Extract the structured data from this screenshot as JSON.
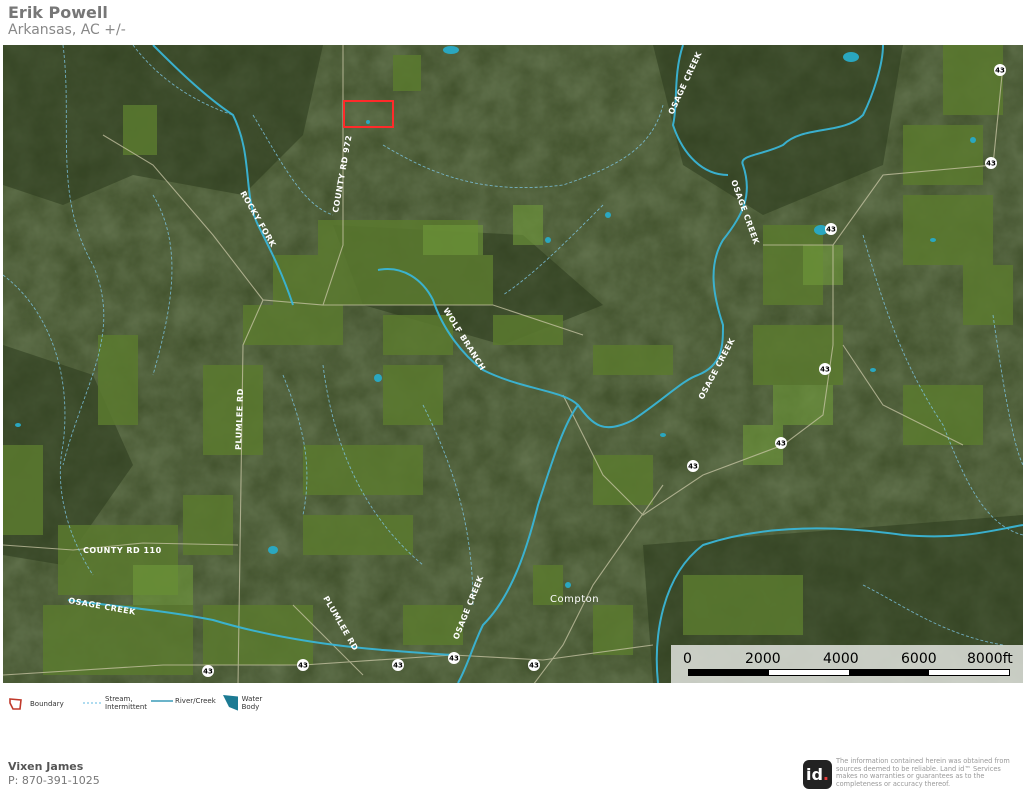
{
  "header": {
    "title": "Erik Powell",
    "subtitle": "Arkansas,  AC +/-"
  },
  "map": {
    "road_labels": {
      "county_rd_972": "COUNTY RD 972",
      "rocky_fork": "ROCKY FORK",
      "wolf_branch": "WOLF BRANCH",
      "osage_creek": "OSAGE CREEK",
      "plumlee_rd": "PLUMLEE RD",
      "county_rd_110": "COUNTY RD 110",
      "compton": "Compton"
    },
    "highway_shield": "43",
    "colors": {
      "boundary": "#ff2a2a",
      "river": "#3ab5d6",
      "stream": "#7fc8e8",
      "water_body": "#1c7a93"
    }
  },
  "scale_bar": {
    "labels": [
      "0",
      "2000",
      "4000",
      "6000",
      "8000ft"
    ]
  },
  "legend": {
    "boundary": "Boundary",
    "stream": "Stream, Intermittent",
    "stream_line1": "Stream,",
    "stream_line2": "Intermittent",
    "river": "River/Creek",
    "water_body": "Water Body"
  },
  "contact": {
    "name": "Vixen James",
    "phone": "P: 870-391-1025"
  },
  "footer": {
    "logo_text": "id",
    "logo_dot": ".",
    "disclaimer": "The information contained herein was obtained from sources deemed to be reliable. Land id™ Services makes no warranties or guarantees as to the completeness or accuracy thereof."
  }
}
